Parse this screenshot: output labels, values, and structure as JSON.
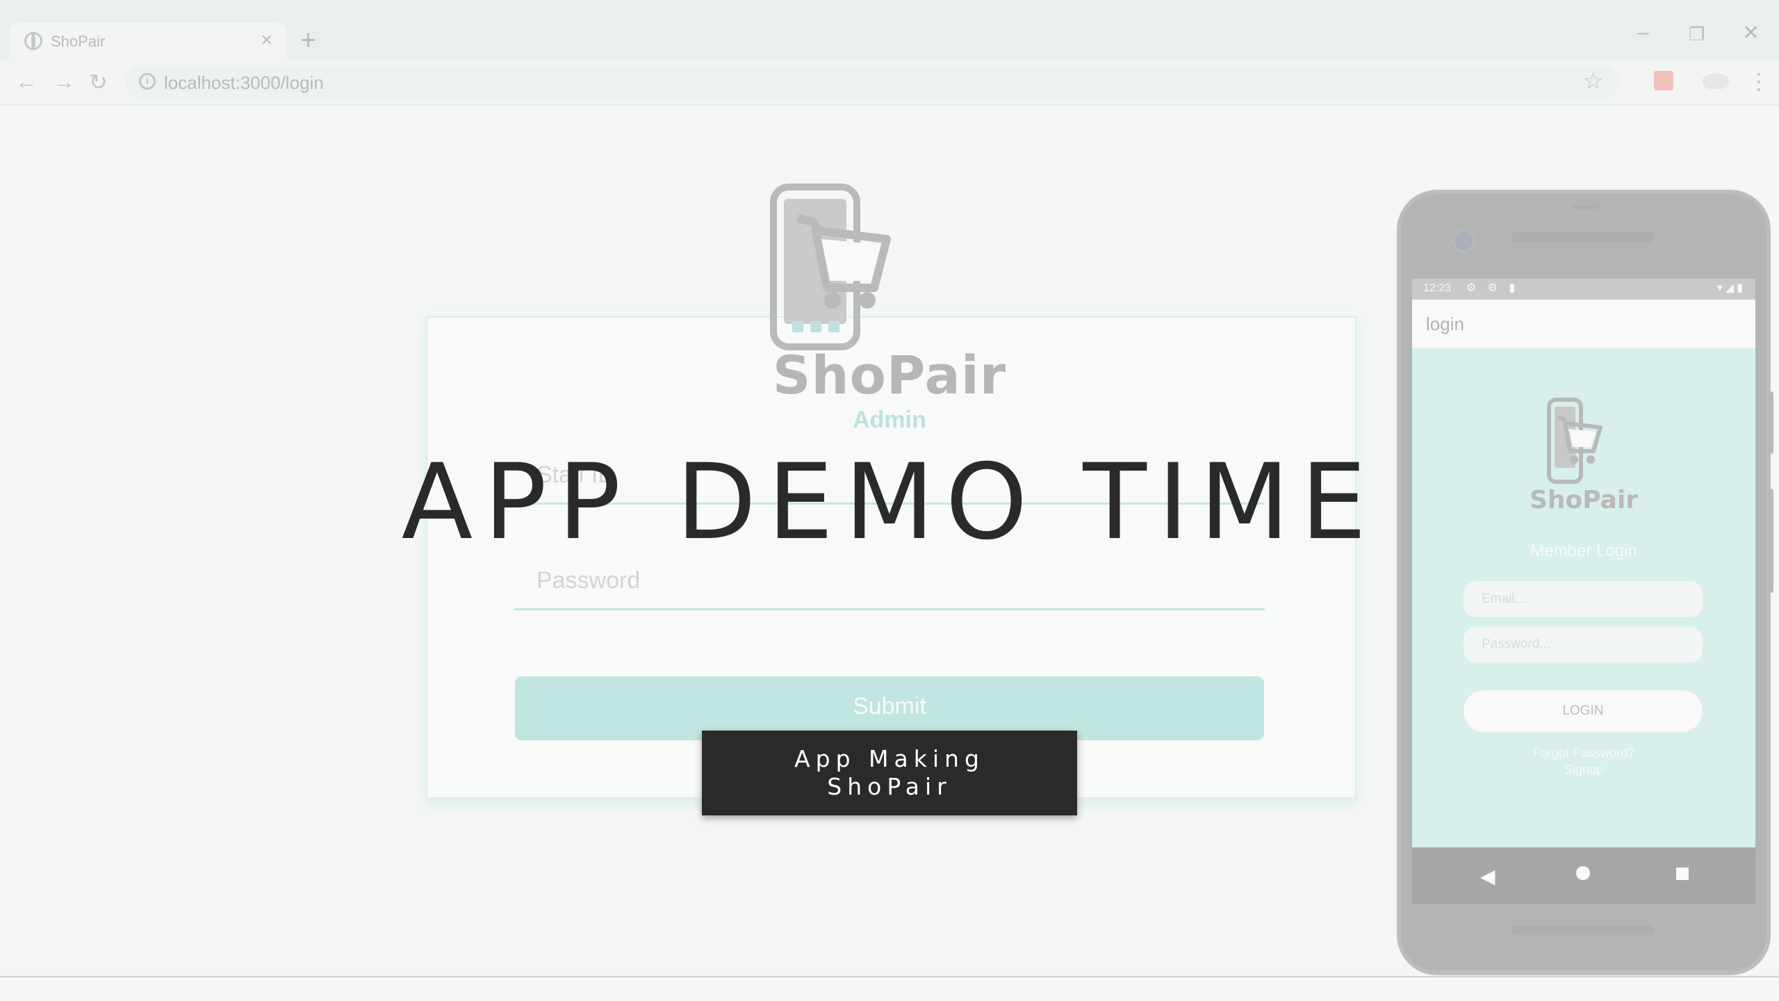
{
  "browser": {
    "tab_title": "ShoPair",
    "tab_close": "×",
    "new_tab": "+",
    "url": "localhost:3000/login",
    "icons": {
      "back": "←",
      "forward": "→",
      "reload": "↻",
      "star": "☆",
      "menu": "⋮",
      "minimize": "–",
      "restore": "❐",
      "close": "✕",
      "info": "i"
    }
  },
  "admin": {
    "brand": "ShoPair",
    "role": "Admin",
    "staff_placeholder": "Staff ID",
    "password_placeholder": "Password",
    "submit_label": "Submit"
  },
  "phone": {
    "status_time": "12:23",
    "status_icons": "⚙ ⚙ ▮",
    "status_right": "▾◢▮",
    "appbar_title": "login",
    "brand": "ShoPair",
    "member_login": "Member Login",
    "email_placeholder": "Email...",
    "password_placeholder": "Password...",
    "login_label": "LOGIN",
    "forgot_link": "Forgot Password?",
    "signup_link": "Signup",
    "nav_back": "◀"
  },
  "overlay": {
    "headline": "APP DEMO TIME",
    "subtitle_line1": "App Making",
    "subtitle_line2": "ShoPair"
  },
  "colors": {
    "accent": "#52c0b5",
    "overlay_box": "#2a2a2a",
    "headline": "#2a2a2a"
  }
}
